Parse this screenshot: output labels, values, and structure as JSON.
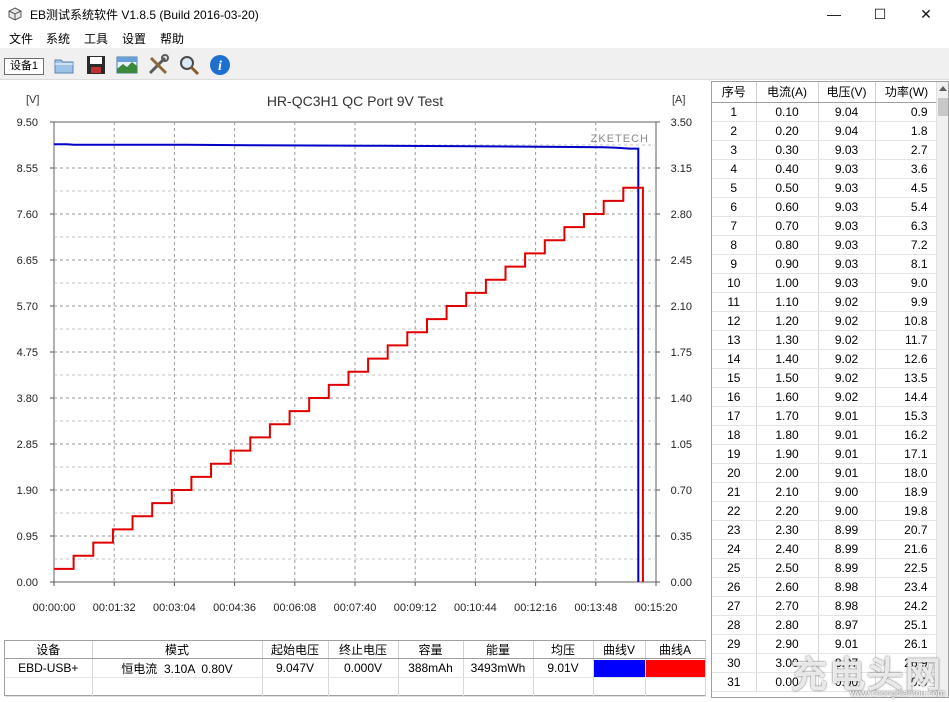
{
  "window": {
    "title": "EB测试系统软件 V1.8.5 (Build 2016-03-20)",
    "minimize": "—",
    "maximize": "☐",
    "close": "✕"
  },
  "menu": [
    "文件",
    "系统",
    "工具",
    "设置",
    "帮助"
  ],
  "toolbar": {
    "device_tab": "设备1",
    "icons": [
      "open-folder-icon",
      "save-disk-icon",
      "chart-image-icon",
      "tools-icon",
      "search-icon",
      "info-icon"
    ]
  },
  "chart_data": {
    "type": "line",
    "title": "HR-QC3H1 QC Port 9V Test",
    "brand": "ZKETECH",
    "y_left_unit": "[V]",
    "y_right_unit": "[A]",
    "y_left_ticks": [
      "9.50",
      "8.55",
      "7.60",
      "6.65",
      "5.70",
      "4.75",
      "3.80",
      "2.85",
      "1.90",
      "0.95",
      "0.00"
    ],
    "y_right_ticks": [
      "3.50",
      "3.15",
      "2.80",
      "2.45",
      "2.10",
      "1.75",
      "1.40",
      "1.05",
      "0.70",
      "0.35",
      "0.00"
    ],
    "x_ticks": [
      "00:00:00",
      "00:01:32",
      "00:03:04",
      "00:04:36",
      "00:06:08",
      "00:07:40",
      "00:09:12",
      "00:10:44",
      "00:12:16",
      "00:13:48",
      "00:15:20"
    ],
    "ylim_left": [
      0,
      9.5
    ],
    "ylim_right": [
      0,
      3.5
    ],
    "xlim_seconds": [
      0,
      920
    ],
    "grid": true,
    "series": [
      {
        "name": "V",
        "color": "#0000c8",
        "axis": "left",
        "points": [
          [
            0,
            9.04
          ],
          [
            20,
            9.04
          ],
          [
            30,
            9.03
          ],
          [
            200,
            9.03
          ],
          [
            300,
            9.02
          ],
          [
            480,
            9.01
          ],
          [
            640,
            9.0
          ],
          [
            840,
            8.98
          ],
          [
            860,
            8.97
          ],
          [
            880,
            8.95
          ],
          [
            893,
            8.95
          ],
          [
            893,
            0.0
          ]
        ]
      },
      {
        "name": "A",
        "color": "#e00000",
        "axis": "right",
        "points": [
          [
            0,
            0.1
          ],
          [
            30,
            0.1
          ],
          [
            30,
            0.2
          ],
          [
            60,
            0.2
          ],
          [
            60,
            0.3
          ],
          [
            90,
            0.3
          ],
          [
            90,
            0.4
          ],
          [
            120,
            0.4
          ],
          [
            120,
            0.5
          ],
          [
            150,
            0.5
          ],
          [
            150,
            0.6
          ],
          [
            180,
            0.6
          ],
          [
            180,
            0.7
          ],
          [
            210,
            0.7
          ],
          [
            210,
            0.8
          ],
          [
            240,
            0.8
          ],
          [
            240,
            0.9
          ],
          [
            270,
            0.9
          ],
          [
            270,
            1.0
          ],
          [
            300,
            1.0
          ],
          [
            300,
            1.1
          ],
          [
            330,
            1.1
          ],
          [
            330,
            1.2
          ],
          [
            360,
            1.2
          ],
          [
            360,
            1.3
          ],
          [
            390,
            1.3
          ],
          [
            390,
            1.4
          ],
          [
            420,
            1.4
          ],
          [
            420,
            1.5
          ],
          [
            450,
            1.5
          ],
          [
            450,
            1.6
          ],
          [
            480,
            1.6
          ],
          [
            480,
            1.7
          ],
          [
            510,
            1.7
          ],
          [
            510,
            1.8
          ],
          [
            540,
            1.8
          ],
          [
            540,
            1.9
          ],
          [
            570,
            1.9
          ],
          [
            570,
            2.0
          ],
          [
            600,
            2.0
          ],
          [
            600,
            2.1
          ],
          [
            630,
            2.1
          ],
          [
            630,
            2.2
          ],
          [
            660,
            2.2
          ],
          [
            660,
            2.3
          ],
          [
            690,
            2.3
          ],
          [
            690,
            2.4
          ],
          [
            720,
            2.4
          ],
          [
            720,
            2.5
          ],
          [
            750,
            2.5
          ],
          [
            750,
            2.6
          ],
          [
            780,
            2.6
          ],
          [
            780,
            2.7
          ],
          [
            810,
            2.7
          ],
          [
            810,
            2.8
          ],
          [
            840,
            2.8
          ],
          [
            840,
            2.9
          ],
          [
            870,
            2.9
          ],
          [
            870,
            3.0
          ],
          [
            900,
            3.0
          ],
          [
            900,
            0.0
          ]
        ]
      }
    ]
  },
  "data_table": {
    "headers": [
      "序号",
      "电流(A)",
      "电压(V)",
      "功率(W)"
    ],
    "rows": [
      [
        "1",
        "0.10",
        "9.04",
        "0.9"
      ],
      [
        "2",
        "0.20",
        "9.04",
        "1.8"
      ],
      [
        "3",
        "0.30",
        "9.03",
        "2.7"
      ],
      [
        "4",
        "0.40",
        "9.03",
        "3.6"
      ],
      [
        "5",
        "0.50",
        "9.03",
        "4.5"
      ],
      [
        "6",
        "0.60",
        "9.03",
        "5.4"
      ],
      [
        "7",
        "0.70",
        "9.03",
        "6.3"
      ],
      [
        "8",
        "0.80",
        "9.03",
        "7.2"
      ],
      [
        "9",
        "0.90",
        "9.03",
        "8.1"
      ],
      [
        "10",
        "1.00",
        "9.03",
        "9.0"
      ],
      [
        "11",
        "1.10",
        "9.02",
        "9.9"
      ],
      [
        "12",
        "1.20",
        "9.02",
        "10.8"
      ],
      [
        "13",
        "1.30",
        "9.02",
        "11.7"
      ],
      [
        "14",
        "1.40",
        "9.02",
        "12.6"
      ],
      [
        "15",
        "1.50",
        "9.02",
        "13.5"
      ],
      [
        "16",
        "1.60",
        "9.02",
        "14.4"
      ],
      [
        "17",
        "1.70",
        "9.01",
        "15.3"
      ],
      [
        "18",
        "1.80",
        "9.01",
        "16.2"
      ],
      [
        "19",
        "1.90",
        "9.01",
        "17.1"
      ],
      [
        "20",
        "2.00",
        "9.01",
        "18.0"
      ],
      [
        "21",
        "2.10",
        "9.00",
        "18.9"
      ],
      [
        "22",
        "2.20",
        "9.00",
        "19.8"
      ],
      [
        "23",
        "2.30",
        "8.99",
        "20.7"
      ],
      [
        "24",
        "2.40",
        "8.99",
        "21.6"
      ],
      [
        "25",
        "2.50",
        "8.99",
        "22.5"
      ],
      [
        "26",
        "2.60",
        "8.98",
        "23.4"
      ],
      [
        "27",
        "2.70",
        "8.98",
        "24.2"
      ],
      [
        "28",
        "2.80",
        "8.97",
        "25.1"
      ],
      [
        "29",
        "2.90",
        "9.01",
        "26.1"
      ],
      [
        "30",
        "3.00",
        "8.97",
        "26.9"
      ],
      [
        "31",
        "0.00",
        "0.00",
        "0.0"
      ]
    ]
  },
  "summary": {
    "headers": [
      "设备",
      "模式",
      "起始电压",
      "终止电压",
      "容量",
      "能量",
      "均压",
      "曲线V",
      "曲线A"
    ],
    "row": [
      "EBD-USB+",
      "恒电流  3.10A  0.80V",
      "9.047V",
      "0.000V",
      "388mAh",
      "3493mWh",
      "9.01V"
    ],
    "curve_v_color": "#0000ff",
    "curve_a_color": "#ff0000"
  },
  "watermark": {
    "text": "充电头网",
    "url": "www.chongdiantou.com"
  }
}
